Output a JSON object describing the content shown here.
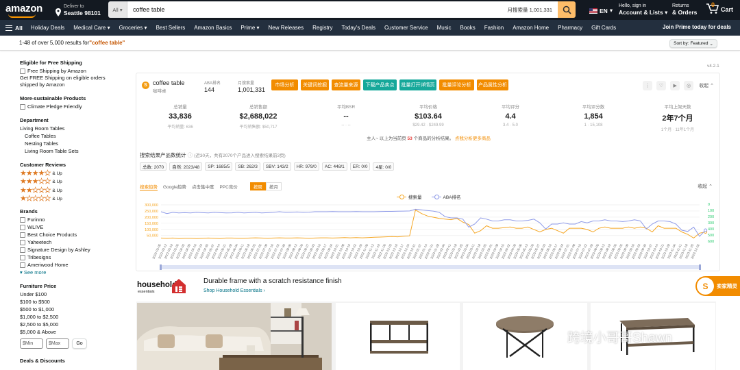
{
  "header": {
    "deliver_line1": "Deliver to",
    "deliver_line2": "Seattle 98101",
    "search_category": "All",
    "search_query": "coffee table",
    "monthly_search_volume": "月搜索量 1,001,331",
    "language": "EN",
    "account_line1": "Hello, sign in",
    "account_line2": "Account & Lists",
    "orders_line1": "Returns",
    "orders_line2": "& Orders",
    "cart_count": "0",
    "cart_label": "Cart"
  },
  "subnav": {
    "all_label": "All",
    "items": [
      "Holiday Deals",
      "Medical Care",
      "Groceries",
      "Best Sellers",
      "Amazon Basics",
      "Prime",
      "New Releases",
      "Registry",
      "Today's Deals",
      "Customer Service",
      "Music",
      "Books",
      "Fashion",
      "Amazon Home",
      "Pharmacy",
      "Gift Cards"
    ],
    "prime_promo": "Join Prime today for deals"
  },
  "results": {
    "prefix": "1-48 of over 5,000 results for ",
    "query": "\"coffee table\"",
    "sort_label": "Sort by:",
    "sort_value": "Featured"
  },
  "sidebar": {
    "free_shipping_title": "Eligible for Free Shipping",
    "free_shipping_option": "Free Shipping by Amazon",
    "free_shipping_note": "Get FREE Shipping on eligible orders shipped by Amazon",
    "sustainable_title": "More-sustainable Products",
    "sustainable_option": "Climate Pledge Friendly",
    "department_title": "Department",
    "department_top": "Living Room Tables",
    "department_items": [
      "Coffee Tables",
      "Nesting Tables",
      "Living Room Table Sets"
    ],
    "reviews_title": "Customer Reviews",
    "reviews_up": "& Up",
    "review_levels": [
      4,
      3,
      2,
      1
    ],
    "brands_title": "Brands",
    "brands": [
      "Furinno",
      "WLIVE",
      "Best Choice Products",
      "Yaheetech",
      "Signature Design by Ashley",
      "Tribesigns",
      "Ameriwood Home"
    ],
    "see_more": "See more",
    "price_title": "Furniture Price",
    "prices": [
      "Under $100",
      "$100 to $500",
      "$500 to $1,000",
      "$1,000 to $2,500",
      "$2,500 to $5,000",
      "$5,000 & Above"
    ],
    "min_placeholder": "$Min",
    "max_placeholder": "$Max",
    "go_label": "Go",
    "deals_title": "Deals & Discounts"
  },
  "plugin": {
    "version": "v4.2.1",
    "keyword": "coffee table",
    "keyword_cn": "咖啡桌",
    "aba_label": "ABA排名",
    "aba_value": "144",
    "volume_label": "月搜索量",
    "volume_value": "1,001,331",
    "buttons": [
      {
        "label": "市场分析",
        "color": "orange"
      },
      {
        "label": "关键词挖掘",
        "color": "orange"
      },
      {
        "label": "查流量来源",
        "color": "orange"
      },
      {
        "label": "下载产品卖点",
        "color": "teal"
      },
      {
        "label": "批量打开详情页",
        "color": "teal"
      },
      {
        "label": "批量评论分析",
        "color": "orange"
      },
      {
        "label": "产品属性分析",
        "color": "orange"
      }
    ],
    "collapse_label": "收起",
    "stats": [
      {
        "label": "总销量",
        "value": "33,836",
        "sub": "平均销量: 636"
      },
      {
        "label": "总销售额",
        "value": "$2,688,022",
        "sub": "平均销售额: $50,717"
      },
      {
        "label": "平均BSR",
        "value": "--",
        "sub": "-- · --"
      },
      {
        "label": "平均价格",
        "value": "$103.64",
        "sub": "$29.42 · $249.99"
      },
      {
        "label": "平均评分",
        "value": "4.4",
        "sub": "3.4 · 5.0"
      },
      {
        "label": "平均评分数",
        "value": "1,854",
        "sub": "1 · 15,108"
      },
      {
        "label": "平均上架天数",
        "value": "2年7个月",
        "sub": "1个月 · 11年1个月"
      }
    ],
    "notice_pre": "主人~ 以上为当前页",
    "notice_num": "53",
    "notice_post": "个商品的分析结果。",
    "notice_link": "点我分析更多商品",
    "section_title": "搜索结果产品数统计",
    "section_sub": "(近30天，共有2070个产品进入搜索结果前3页)",
    "tags": [
      "总数: 2070",
      "自然: 2023/48",
      "SP: 1685/5",
      "SB: 262/3",
      "SBV: 143/2",
      "HR: 979/0",
      "AC: 448/1",
      "ER: 0/0",
      "4星: 0/0"
    ],
    "tabs": [
      "搜索趋势",
      "Google趋势",
      "点击集中度",
      "PPC竞价"
    ],
    "toggle": [
      "按周",
      "按月"
    ],
    "chart_collapse": "收起"
  },
  "chart_data": {
    "type": "line",
    "x_tick_labels": [
      "2022-03-05",
      "2022-03-12",
      "2022-03-19",
      "2022-03-26",
      "2022-04-02",
      "2022-04-09",
      "2022-04-16",
      "2022-04-23",
      "2022-04-30",
      "2022-05-07",
      "2022-05-14",
      "2022-05-21",
      "2022-05-28",
      "2022-06-04",
      "2022-06-11",
      "2022-06-18",
      "2022-06-25",
      "2022-07-02",
      "2022-07-09",
      "2022-07-16",
      "2022-07-23",
      "2022-07-30",
      "2022-08-06",
      "2022-08-13",
      "2022-08-20",
      "2022-08-27",
      "2022-09-03",
      "2022-09-10",
      "2022-09-17",
      "2022-09-24",
      "2022-10-01",
      "2022-10-08",
      "2022-10-15",
      "2022-10-22",
      "2022-10-29",
      "2022-11-05",
      "2022-11-12",
      "2022-11-19",
      "2022-11-26",
      "2022-12-03",
      "2022-12-10",
      "2022-12-17",
      "2022-12-24",
      "2022-12-31",
      "2023-01-07",
      "2023-01-14",
      "2023-01-21",
      "2023-01-28",
      "2023-02-04",
      "2023-02-11",
      "2023-02-18",
      "2023-02-25",
      "2023-03-04",
      "2023-03-11",
      "2023-03-18",
      "2023-03-25",
      "2023-04-01",
      "2023-04-08",
      "2023-04-15",
      "2023-04-22",
      "2023-04-29",
      "2023-05-06",
      "2023-05-13",
      "2023-05-20",
      "2023-05-27",
      "2023-06-03",
      "2023-06-10",
      "2023-06-17",
      "2023-06-24",
      "2023-07-01",
      "2023-07-08",
      "2023-07-15",
      "2023-07-22",
      "2023-07-29",
      "2023-08-05",
      "2023-08-12",
      "2023-08-19",
      "2023-08-26",
      "2023-09-02",
      "2023-09-09",
      "2023-09-16",
      "2023-09-23",
      "2023-09-30",
      "2023-10-07",
      "2023-10-14",
      "2023-10-21",
      "2023-10-28",
      "2023-11-04",
      "2023-11-11",
      "2023-11-18",
      "2023-11-25",
      "2023-12-02"
    ],
    "left_axis": {
      "ticks": [
        "300,000",
        "250,000",
        "200,000",
        "150,000",
        "100,000",
        "50,000"
      ],
      "ylim": [
        50000,
        300000
      ]
    },
    "right_axis": {
      "ticks": [
        "0",
        "100",
        "200",
        "300",
        "400",
        "500",
        "600"
      ],
      "ylim": [
        0,
        600
      ],
      "inverted": true
    },
    "series": [
      {
        "name": "搜索量",
        "color": "#f5a623",
        "axis": "left",
        "values": [
          70000,
          68000,
          70000,
          66000,
          68000,
          68000,
          66000,
          68000,
          70000,
          68000,
          66000,
          70000,
          70000,
          68000,
          68000,
          70000,
          72000,
          70000,
          68000,
          70000,
          72000,
          70000,
          70000,
          72000,
          70000,
          68000,
          70000,
          72000,
          72000,
          70000,
          72000,
          74000,
          72000,
          74000,
          72000,
          74000,
          76000,
          78000,
          80000,
          82000,
          80000,
          85000,
          88000,
          300000,
          270000,
          250000,
          240000,
          230000,
          225000,
          220000,
          230000,
          200000,
          180000,
          110000,
          130000,
          170000,
          150000,
          150000,
          155000,
          160000,
          150000,
          150000,
          160000,
          140000,
          120000,
          140000,
          150000,
          130000,
          110000,
          150000,
          150000,
          150000,
          140000,
          120000,
          150000,
          160000,
          150000,
          150000,
          150000,
          160000,
          150000,
          160000,
          150000,
          120000,
          170000,
          150000,
          150000,
          150000,
          120000,
          100000,
          70000,
          110000,
          120000
        ]
      },
      {
        "name": "ABA排名",
        "color": "#8e9ae8",
        "axis": "right",
        "values": [
          100,
          130,
          110,
          120,
          115,
          120,
          110,
          115,
          120,
          110,
          115,
          120,
          118,
          110,
          120,
          115,
          110,
          120,
          115,
          110,
          100,
          110,
          108,
          105,
          110,
          108,
          100,
          100,
          100,
          98,
          100,
          100,
          100,
          98,
          100,
          100,
          100,
          98,
          95,
          95,
          92,
          90,
          88,
          60,
          70,
          80,
          90,
          110,
          180,
          200,
          200,
          220,
          350,
          300,
          200,
          220,
          250,
          250,
          230,
          230,
          250,
          250,
          240,
          220,
          280,
          380,
          300,
          300,
          280,
          300,
          300,
          260,
          280,
          250,
          250,
          230,
          250,
          250,
          260,
          250,
          230,
          250,
          380,
          300,
          250,
          250,
          260,
          300,
          400,
          420,
          350,
          500,
          400
        ]
      }
    ]
  },
  "ad": {
    "brand_line1": "household",
    "brand_line2": "essentials",
    "headline": "Durable frame with a scratch resistance finish",
    "link": "Shop Household Essentials ›"
  },
  "assistant_label": "卖家精灵",
  "watermark": "跨境小哥哥Shawn"
}
